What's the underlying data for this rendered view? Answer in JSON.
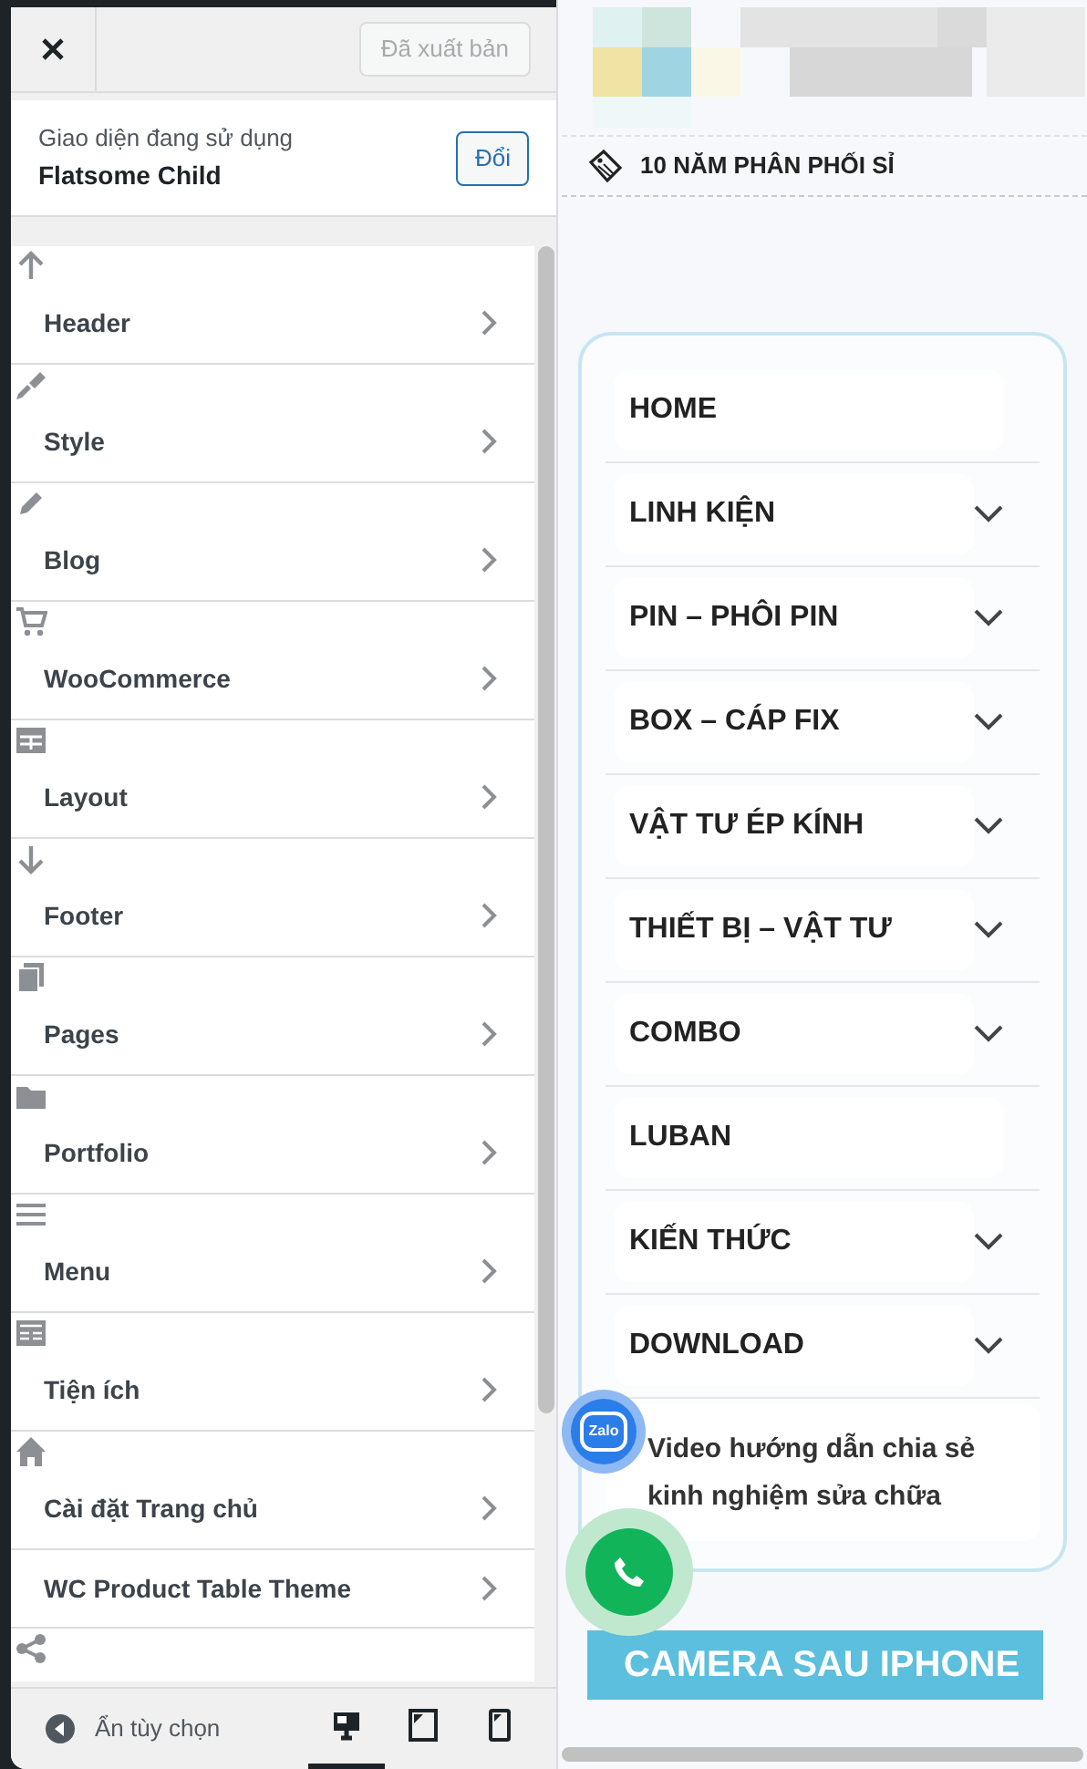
{
  "top_bar": {
    "publish_button": "Đã xuất bản"
  },
  "theme": {
    "caption": "Giao diện đang sử dụng",
    "name": "Flatsome Child",
    "change_button": "Đổi"
  },
  "panel_items": [
    {
      "label": "Header"
    },
    {
      "label": "Style"
    },
    {
      "label": "Blog"
    },
    {
      "label": "WooCommerce"
    },
    {
      "label": "Layout"
    },
    {
      "label": "Footer"
    },
    {
      "label": "Pages"
    },
    {
      "label": "Portfolio"
    },
    {
      "label": "Menu"
    },
    {
      "label": "Tiện ích"
    },
    {
      "label": "Cài đặt Trang chủ"
    },
    {
      "label": "WC Product Table Theme"
    }
  ],
  "footer": {
    "hide_controls": "Ẩn tùy chọn",
    "devices": [
      {
        "selected": true
      },
      {
        "selected": false
      },
      {
        "selected": false
      }
    ]
  },
  "preview": {
    "tagline": "10 NĂM PHÂN PHỐI SỈ",
    "menu": [
      {
        "label": "HOME",
        "has_submenu": false
      },
      {
        "label": "LINH KIỆN",
        "has_submenu": true
      },
      {
        "label": "PIN – PHÔI PIN",
        "has_submenu": true
      },
      {
        "label": "BOX – CÁP FIX",
        "has_submenu": true
      },
      {
        "label": "VẬT TƯ ÉP KÍNH",
        "has_submenu": true
      },
      {
        "label": "THIẾT BỊ – VẬT TƯ",
        "has_submenu": true
      },
      {
        "label": "COMBO",
        "has_submenu": true
      },
      {
        "label": "LUBAN",
        "has_submenu": false
      },
      {
        "label": "KIẾN THỨC",
        "has_submenu": true
      },
      {
        "label": "DOWNLOAD",
        "has_submenu": true
      },
      {
        "label": "Video hướng dẫn chia sẻ kinh nghiệm sửa chữa",
        "has_submenu": false,
        "kind": "card"
      }
    ],
    "banner": "CAMERA SAU IPHONE",
    "zalo_button": "Zalo"
  }
}
